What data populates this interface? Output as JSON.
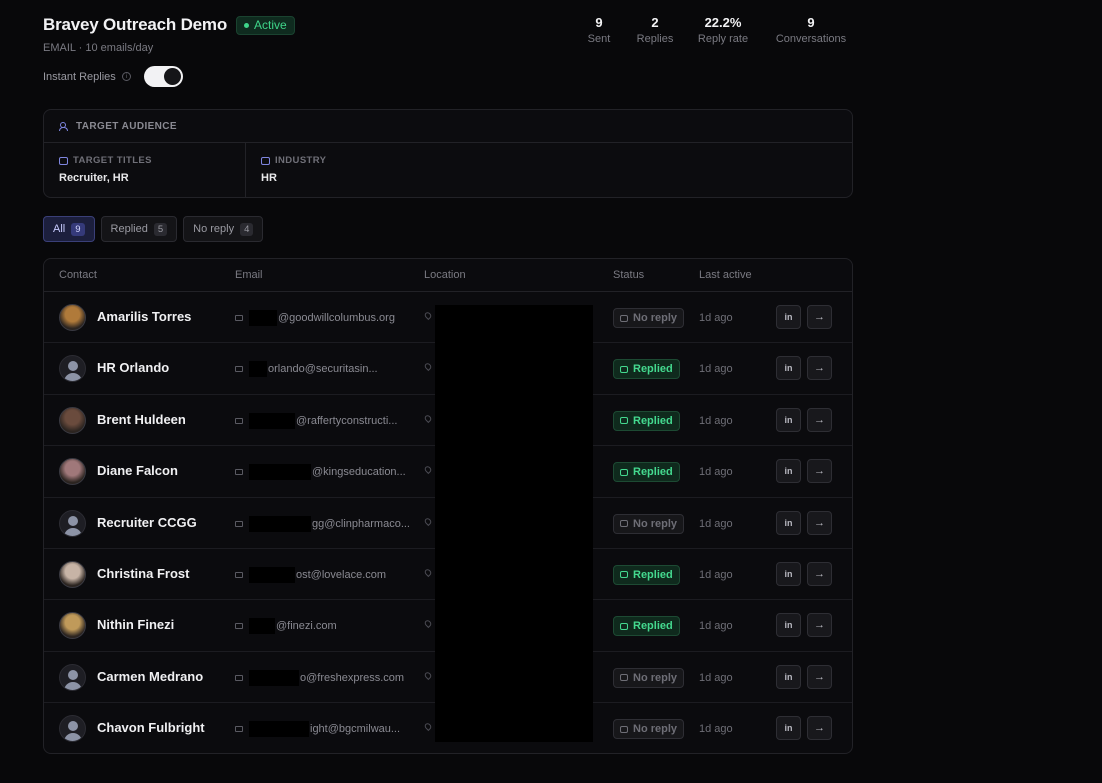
{
  "campaign": {
    "title": "Bravey Outreach Demo",
    "status": "Active",
    "subtitle": "EMAIL · 10 emails/day",
    "instant_replies_label": "Instant Replies",
    "instant_replies_on": true
  },
  "stats": [
    {
      "value": "9",
      "label": "Sent"
    },
    {
      "value": "2",
      "label": "Replies"
    },
    {
      "value": "22.2%",
      "label": "Reply rate"
    },
    {
      "value": "9",
      "label": "Conversations"
    }
  ],
  "audience": {
    "header": "TARGET AUDIENCE",
    "titles_label": "TARGET TITLES",
    "titles_value": "Recruiter, HR",
    "industry_label": "INDUSTRY",
    "industry_value": "HR"
  },
  "filters": [
    {
      "label": "All",
      "count": "9",
      "active": true
    },
    {
      "label": "Replied",
      "count": "5",
      "active": false
    },
    {
      "label": "No reply",
      "count": "4",
      "active": false
    }
  ],
  "table": {
    "columns": [
      "Contact",
      "Email",
      "Location",
      "Status",
      "Last active"
    ],
    "rows": [
      {
        "name": "Amarilis Torres",
        "email_visible": "@goodwillcolumbus.org",
        "status": "No reply",
        "last_active": "1d ago",
        "avatar": "photo"
      },
      {
        "name": "HR Orlando",
        "email_visible": "orlando@securitasin...",
        "status": "Replied",
        "last_active": "1d ago",
        "avatar": "placeholder"
      },
      {
        "name": "Brent Huldeen",
        "email_visible": "@raffertyconstructi...",
        "status": "Replied",
        "last_active": "1d ago",
        "avatar": "photo"
      },
      {
        "name": "Diane Falcon",
        "email_visible": "@kingseducation...",
        "status": "Replied",
        "last_active": "1d ago",
        "avatar": "photo"
      },
      {
        "name": "Recruiter CCGG",
        "email_visible": "gg@clinpharmaco...",
        "status": "No reply",
        "last_active": "1d ago",
        "avatar": "placeholder"
      },
      {
        "name": "Christina Frost",
        "email_visible": "ost@lovelace.com",
        "status": "Replied",
        "last_active": "1d ago",
        "avatar": "photo"
      },
      {
        "name": "Nithin Finezi",
        "email_visible": "@finezi.com",
        "status": "Replied",
        "last_active": "1d ago",
        "avatar": "photo"
      },
      {
        "name": "Carmen Medrano",
        "email_visible": "o@freshexpress.com",
        "status": "No reply",
        "last_active": "1d ago",
        "avatar": "placeholder"
      },
      {
        "name": "Chavon Fulbright",
        "email_visible": "ight@bgcmilwau...",
        "status": "No reply",
        "last_active": "1d ago",
        "avatar": "placeholder"
      }
    ]
  }
}
